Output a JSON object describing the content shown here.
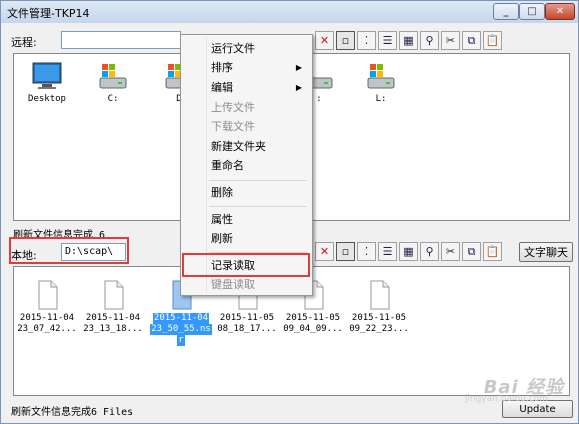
{
  "window": {
    "title": "文件管理-TKP14"
  },
  "remote": {
    "label": "远程:",
    "path": "",
    "items": [
      {
        "name": "Desktop",
        "icon": "desktop-icon"
      },
      {
        "name": "C:",
        "icon": "drive-icon"
      },
      {
        "name": "D",
        "icon": "drive-icon"
      },
      {
        "name": ":",
        "icon": "drive-icon"
      },
      {
        "name": "L:",
        "icon": "drive-icon"
      }
    ],
    "status": "刷新文件信息完成 6"
  },
  "local": {
    "label": "本地:",
    "path": "D:\\scap\\",
    "items": [
      {
        "line1": "2015-11-04",
        "line2": "23_07_42...",
        "line3": "",
        "selected": false
      },
      {
        "line1": "2015-11-04",
        "line2": "23_13_18...",
        "line3": "",
        "selected": false
      },
      {
        "line1": "2015-11-04",
        "line2": "23_50_55.ns",
        "line3": "r",
        "selected": true
      },
      {
        "line1": "2015-11-05",
        "line2": "08_18_17...",
        "line3": "",
        "selected": false
      },
      {
        "line1": "2015-11-05",
        "line2": "09_04_09...",
        "line3": "",
        "selected": false
      },
      {
        "line1": "2015-11-05",
        "line2": "09_22_23...",
        "line3": "",
        "selected": false
      }
    ],
    "status": "刷新文件信息完成6 Files",
    "chat_label": "文字聊天",
    "update_label": "Update"
  },
  "context_menu": {
    "items": [
      {
        "label": "运行文件",
        "disabled": false,
        "submenu": false
      },
      {
        "label": "排序",
        "disabled": false,
        "submenu": true
      },
      {
        "label": "编辑",
        "disabled": false,
        "submenu": true
      },
      {
        "label": "上传文件",
        "disabled": true,
        "submenu": false
      },
      {
        "label": "下载文件",
        "disabled": true,
        "submenu": false
      },
      {
        "label": "新建文件夹",
        "disabled": false,
        "submenu": false
      },
      {
        "label": "重命名",
        "disabled": false,
        "submenu": false
      },
      {
        "label": "删除",
        "disabled": false,
        "submenu": false
      },
      {
        "label": "属性",
        "disabled": false,
        "submenu": false
      },
      {
        "label": "刷新",
        "disabled": false,
        "submenu": false
      },
      {
        "label": "记录读取",
        "disabled": false,
        "submenu": false
      },
      {
        "label": "键盘读取",
        "disabled": true,
        "submenu": false
      }
    ]
  },
  "watermark": {
    "text": "Bai 经验",
    "sub": "jingyan.baidu.com"
  },
  "colors": {
    "highlight": "#e23b3b",
    "selection": "#3399ff"
  }
}
